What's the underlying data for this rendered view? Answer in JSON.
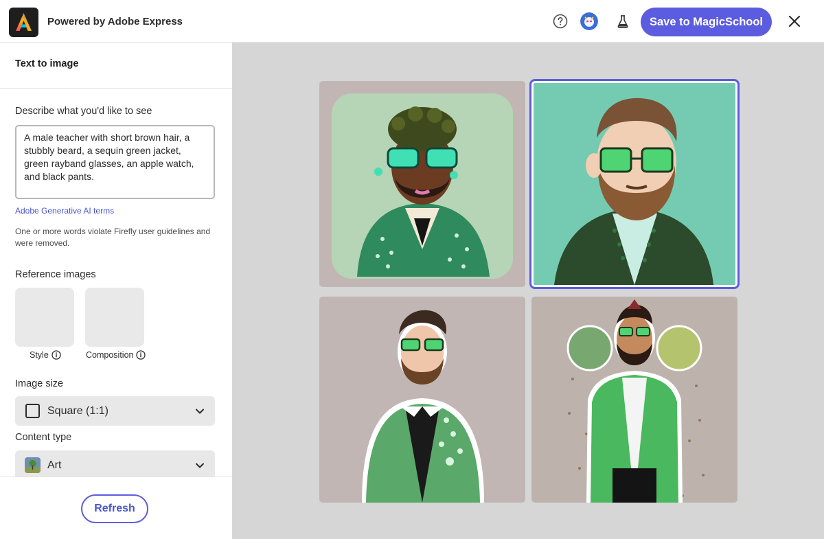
{
  "header": {
    "brand": "Powered by Adobe Express",
    "save_label": "Save to MagicSchool"
  },
  "sidebar": {
    "title": "Text to image",
    "prompt_label": "Describe what you'd like to see",
    "prompt_value": "A male teacher with short brown hair,  a stubbly beard, a sequin green jacket, green rayband glasses, an apple watch, and black pants.",
    "terms_link": "Adobe Generative AI terms",
    "warning": "One or more words violate Firefly user guidelines and were removed.",
    "reference_label": "Reference images",
    "reference_tiles": [
      {
        "caption": "Style"
      },
      {
        "caption": "Composition"
      }
    ],
    "image_size_label": "Image size",
    "image_size_value": "Square (1:1)",
    "content_type_label": "Content type",
    "content_type_value": "Art",
    "refresh_label": "Refresh"
  },
  "results": {
    "selected_index": 1,
    "count": 4
  },
  "colors": {
    "accent": "#5c5ce0",
    "canvas_bg": "#d6d6d6",
    "link": "#4b56c8"
  },
  "icons": [
    "adobe-express-logo",
    "help-icon",
    "avatar",
    "lab-flask-icon",
    "close-icon",
    "info-icon",
    "chevron-down-icon",
    "square-aspect-icon",
    "art-content-icon"
  ]
}
